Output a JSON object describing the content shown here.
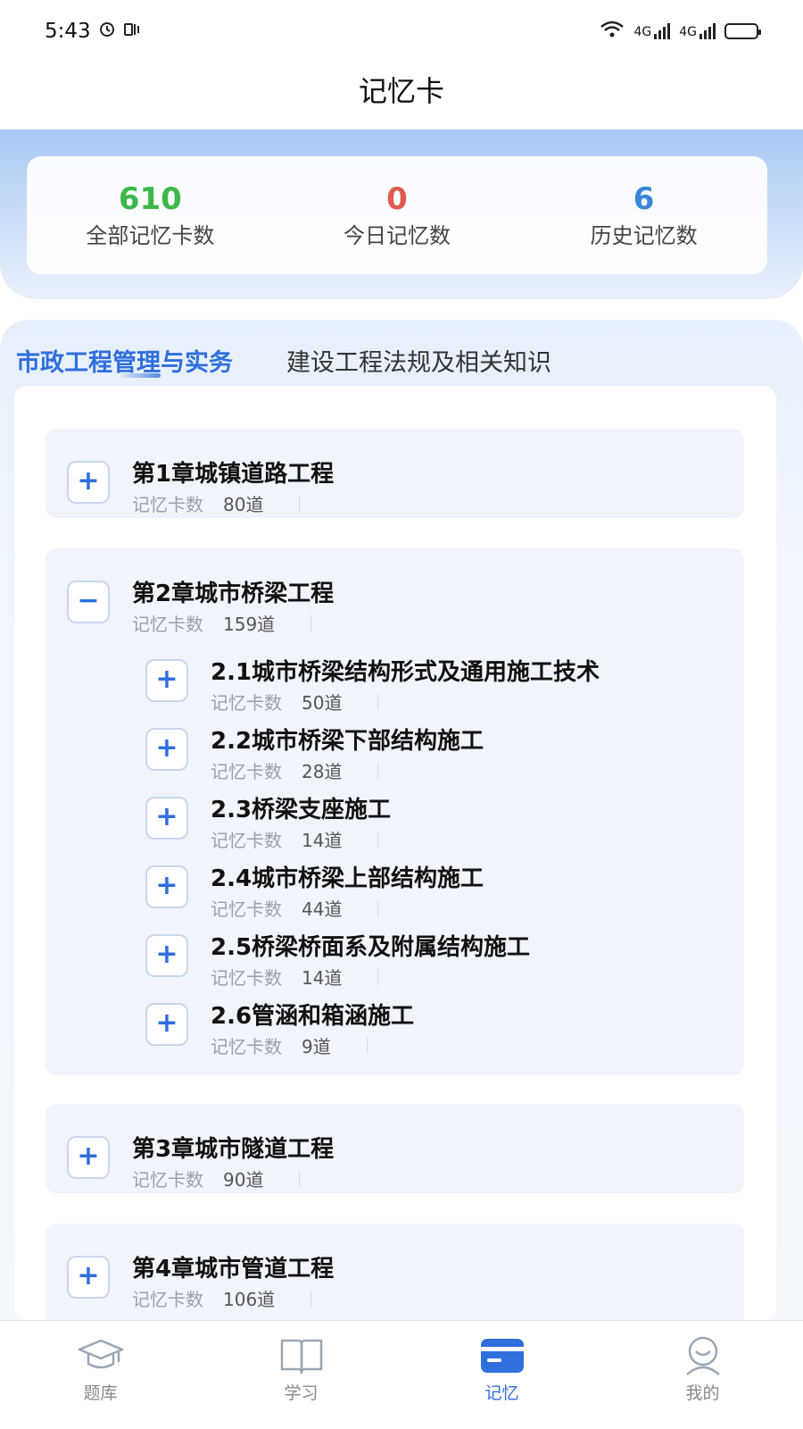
{
  "status_bar": {
    "time": "5:43",
    "network": "4G"
  },
  "header": {
    "title": "记忆卡"
  },
  "stats": [
    {
      "value": "610",
      "label": "全部记忆卡数",
      "color": "#3db84a"
    },
    {
      "value": "0",
      "label": "今日记忆数",
      "color": "#e05a52"
    },
    {
      "value": "6",
      "label": "历史记忆数",
      "color": "#3a86d8"
    }
  ],
  "tabs": [
    {
      "label": "市政工程管理与实务",
      "active": true
    },
    {
      "label": "建设工程法规及相关知识",
      "active": false
    }
  ],
  "count_label": "记忆卡数",
  "chapters": [
    {
      "title": "第1章城镇道路工程",
      "count": "80道",
      "expanded": false,
      "icon": "plus-icon"
    },
    {
      "title": "第2章城市桥梁工程",
      "count": "159道",
      "expanded": true,
      "icon": "minus-icon",
      "sections": [
        {
          "title": "2.1城市桥梁结构形式及通用施工技术",
          "count": "50道"
        },
        {
          "title": "2.2城市桥梁下部结构施工",
          "count": "28道"
        },
        {
          "title": "2.3桥梁支座施工",
          "count": "14道"
        },
        {
          "title": "2.4城市桥梁上部结构施工",
          "count": "44道"
        },
        {
          "title": "2.5桥梁桥面系及附属结构施工",
          "count": "14道"
        },
        {
          "title": "2.6管涵和箱涵施工",
          "count": "9道"
        }
      ]
    },
    {
      "title": "第3章城市隧道工程",
      "count": "90道",
      "expanded": false,
      "icon": "plus-icon"
    },
    {
      "title": "第4章城市管道工程",
      "count": "106道",
      "expanded": false,
      "icon": "plus-icon"
    }
  ],
  "expand_symbols": {
    "plus": "+",
    "minus": "−"
  },
  "bottom_nav": [
    {
      "label": "题库",
      "icon": "graduation-cap-icon",
      "active": false
    },
    {
      "label": "学习",
      "icon": "book-icon",
      "active": false
    },
    {
      "label": "记忆",
      "icon": "card-icon",
      "active": true
    },
    {
      "label": "我的",
      "icon": "profile-icon",
      "active": false
    }
  ],
  "colors": {
    "accent": "#2f6fde",
    "inactive": "#9aa6b5"
  }
}
